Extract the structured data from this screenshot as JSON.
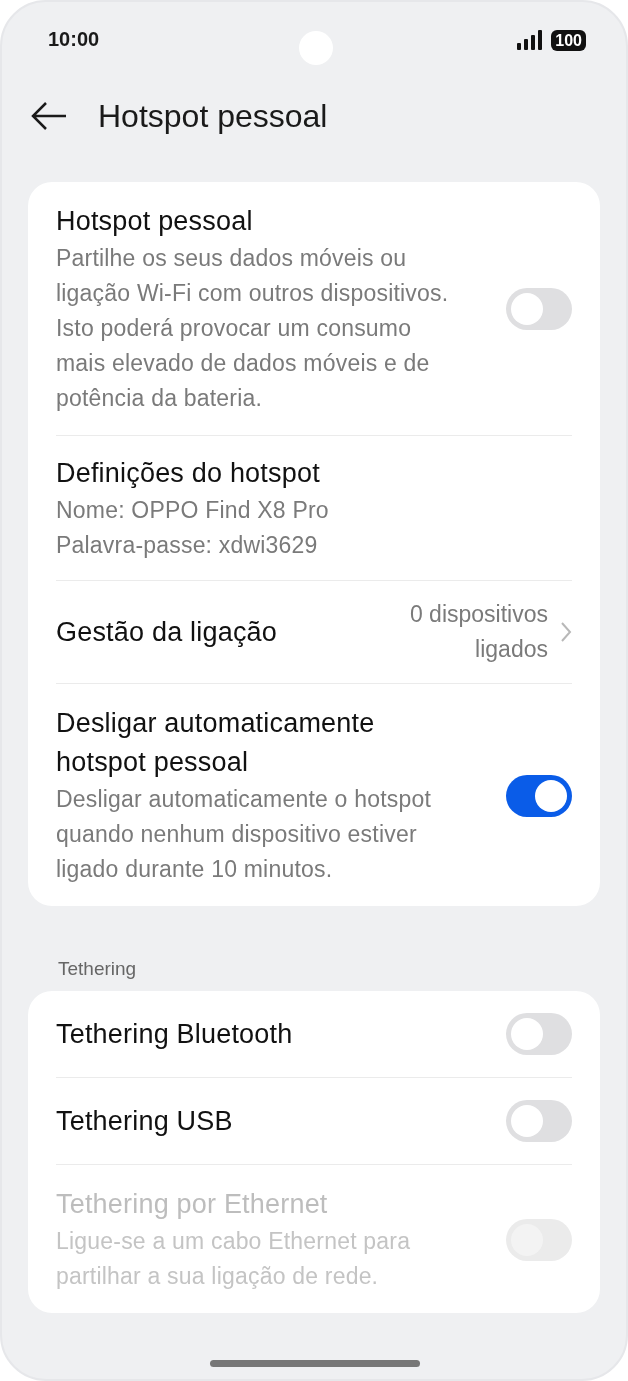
{
  "status_bar": {
    "time": "10:00",
    "battery": "100"
  },
  "header": {
    "title": "Hotspot pessoal"
  },
  "sections": [
    {
      "items": [
        {
          "kind": "toggle",
          "title": "Hotspot pessoal",
          "description": "Partilhe os seus dados móveis ou ligação Wi-Fi com outros dispositivos. Isto poderá provocar um consumo mais elevado de dados móveis e de potência da bateria.",
          "on": false,
          "disabled": false
        },
        {
          "kind": "info",
          "title": "Definições do hotspot",
          "lines": [
            "Nome: OPPO Find X8 Pro",
            "Palavra-passe: xdwi3629"
          ]
        },
        {
          "kind": "link",
          "title": "Gestão da ligação",
          "value": "0 dispositivos ligados"
        },
        {
          "kind": "toggle",
          "title": "Desligar automaticamente hotspot pessoal",
          "description": "Desligar automaticamente o hotspot quando nenhum dispositivo estiver ligado durante 10 minutos.",
          "on": true,
          "disabled": false
        }
      ]
    },
    {
      "label": "Tethering",
      "items": [
        {
          "kind": "toggle",
          "title": "Tethering Bluetooth",
          "on": false,
          "disabled": false
        },
        {
          "kind": "toggle",
          "title": "Tethering USB",
          "on": false,
          "disabled": false
        },
        {
          "kind": "toggle",
          "title": "Tethering por Ethernet",
          "description": "Ligue-se a um cabo Ethernet para partilhar a sua ligação de rede.",
          "on": false,
          "disabled": true
        }
      ]
    }
  ]
}
